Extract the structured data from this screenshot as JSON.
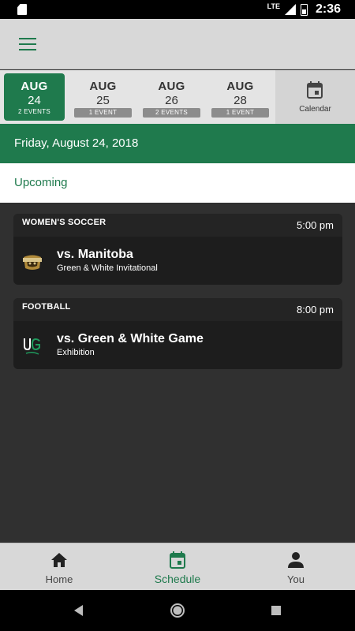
{
  "status_bar": {
    "network": "LTE",
    "time": "2:36"
  },
  "app_bar": {
    "menu_icon": "hamburger-menu-icon"
  },
  "date_strip": {
    "dates": [
      {
        "month": "AUG",
        "day": "24",
        "events": "2 EVENTS",
        "selected": true
      },
      {
        "month": "AUG",
        "day": "25",
        "events": "1 EVENT",
        "selected": false
      },
      {
        "month": "AUG",
        "day": "26",
        "events": "2 EVENTS",
        "selected": false
      },
      {
        "month": "AUG",
        "day": "28",
        "events": "1 EVENT",
        "selected": false
      }
    ],
    "calendar_label": "Calendar"
  },
  "date_header": "Friday, August 24, 2018",
  "section_label": "Upcoming",
  "events": [
    {
      "sport": "WOMEN'S SOCCER",
      "time": "5:00 pm",
      "opponent": "vs. Manitoba",
      "subtitle": "Green & White Invitational",
      "logo": "manitoba-bisons-logo"
    },
    {
      "sport": "FOOTBALL",
      "time": "8:00 pm",
      "opponent": "vs. Green & White Game",
      "subtitle": "Exhibition",
      "logo": "usask-huskies-logo"
    }
  ],
  "bottom_nav": [
    {
      "label": "Home",
      "icon": "home-icon",
      "active": false
    },
    {
      "label": "Schedule",
      "icon": "calendar-icon",
      "active": true
    },
    {
      "label": "You",
      "icon": "person-icon",
      "active": false
    }
  ],
  "colors": {
    "brand_green": "#1f7a4d",
    "card_bg": "#1d1d1d",
    "page_bg": "#303030"
  }
}
